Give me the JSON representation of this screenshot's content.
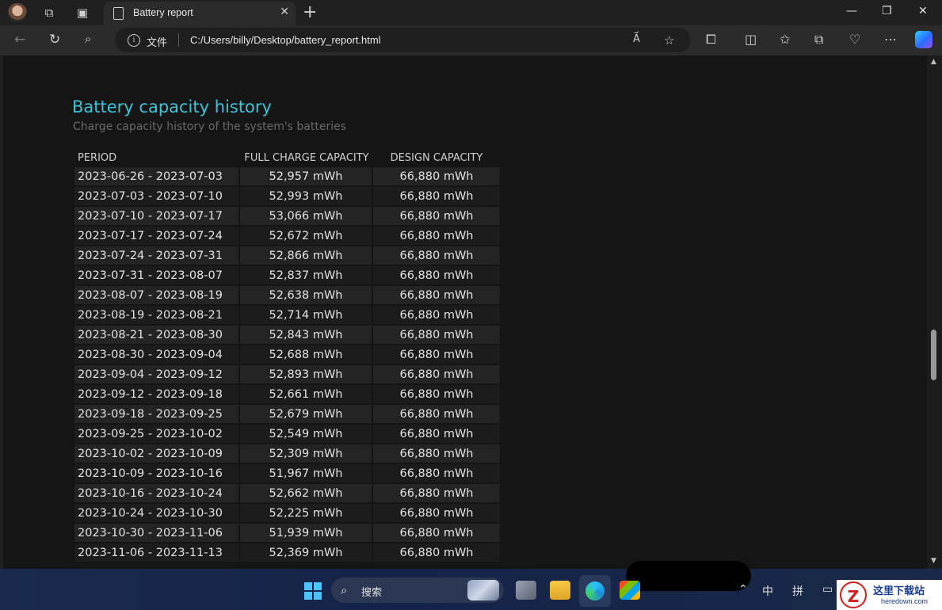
{
  "tab": {
    "title": "Battery report"
  },
  "address": {
    "label": "文件",
    "url": "C:/Users/billy/Desktop/battery_report.html"
  },
  "report": {
    "heading": "Battery capacity history",
    "subheading": "Charge capacity history of the system's batteries",
    "columns": [
      "PERIOD",
      "FULL CHARGE CAPACITY",
      "DESIGN CAPACITY"
    ],
    "rows": [
      [
        "2023-06-26 - 2023-07-03",
        "52,957 mWh",
        "66,880 mWh"
      ],
      [
        "2023-07-03 - 2023-07-10",
        "52,993 mWh",
        "66,880 mWh"
      ],
      [
        "2023-07-10 - 2023-07-17",
        "53,066 mWh",
        "66,880 mWh"
      ],
      [
        "2023-07-17 - 2023-07-24",
        "52,672 mWh",
        "66,880 mWh"
      ],
      [
        "2023-07-24 - 2023-07-31",
        "52,866 mWh",
        "66,880 mWh"
      ],
      [
        "2023-07-31 - 2023-08-07",
        "52,837 mWh",
        "66,880 mWh"
      ],
      [
        "2023-08-07 - 2023-08-19",
        "52,638 mWh",
        "66,880 mWh"
      ],
      [
        "2023-08-19 - 2023-08-21",
        "52,714 mWh",
        "66,880 mWh"
      ],
      [
        "2023-08-21 - 2023-08-30",
        "52,843 mWh",
        "66,880 mWh"
      ],
      [
        "2023-08-30 - 2023-09-04",
        "52,688 mWh",
        "66,880 mWh"
      ],
      [
        "2023-09-04 - 2023-09-12",
        "52,893 mWh",
        "66,880 mWh"
      ],
      [
        "2023-09-12 - 2023-09-18",
        "52,661 mWh",
        "66,880 mWh"
      ],
      [
        "2023-09-18 - 2023-09-25",
        "52,679 mWh",
        "66,880 mWh"
      ],
      [
        "2023-09-25 - 2023-10-02",
        "52,549 mWh",
        "66,880 mWh"
      ],
      [
        "2023-10-02 - 2023-10-09",
        "52,309 mWh",
        "66,880 mWh"
      ],
      [
        "2023-10-09 - 2023-10-16",
        "51,967 mWh",
        "66,880 mWh"
      ],
      [
        "2023-10-16 - 2023-10-24",
        "52,662 mWh",
        "66,880 mWh"
      ],
      [
        "2023-10-24 - 2023-10-30",
        "52,225 mWh",
        "66,880 mWh"
      ],
      [
        "2023-10-30 - 2023-11-06",
        "51,939 mWh",
        "66,880 mWh"
      ],
      [
        "2023-11-06 - 2023-11-13",
        "52,369 mWh",
        "66,880 mWh"
      ]
    ]
  },
  "taskbar": {
    "search_placeholder": "搜索",
    "tray_ime_1": "中",
    "tray_ime_2": "拼"
  },
  "watermark": {
    "cn": "这里下载站",
    "en": "heredown.com",
    "logo_letter": "Z"
  },
  "colors": {
    "heading": "#3ec4d8",
    "accent_windows": "#4cc2ff"
  }
}
